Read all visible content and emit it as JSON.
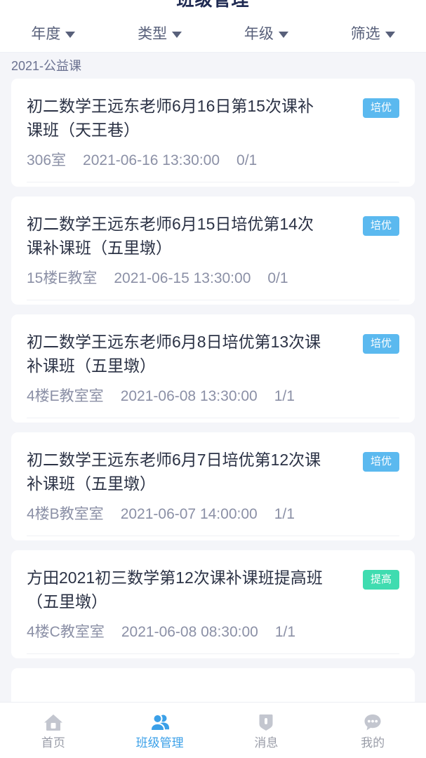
{
  "header": {
    "title": "班级管理"
  },
  "filters": [
    {
      "label": "年度",
      "icon": "chevron-down-icon"
    },
    {
      "label": "类型",
      "icon": "chevron-down-icon"
    },
    {
      "label": "年级",
      "icon": "chevron-down-icon"
    },
    {
      "label": "筛选",
      "icon": "chevron-down-icon"
    }
  ],
  "section": {
    "label": "2021-公益课"
  },
  "colors": {
    "page_background": "#f4f5f9",
    "card_background": "#ffffff",
    "title_text": "#1f2a52",
    "badge_peiyou": "#5bb9ef",
    "badge_tigao": "#3fdcb0",
    "active_tab": "#3ba0e8",
    "inactive_tab": "#9a9da8"
  },
  "classes": [
    {
      "title": "初二数学王远东老师6月16日第15次课补课班（天王巷）",
      "badge": "培优",
      "badge_type": "peiyou",
      "room": "306室",
      "datetime": "2021-06-16 13:30:00",
      "enrollment": "0/1"
    },
    {
      "title": "初二数学王远东老师6月15日培优第14次课补课班（五里墩）",
      "badge": "培优",
      "badge_type": "peiyou",
      "room": "15楼E教室",
      "datetime": "2021-06-15 13:30:00",
      "enrollment": "0/1"
    },
    {
      "title": "初二数学王远东老师6月8日培优第13次课补课班（五里墩）",
      "badge": "培优",
      "badge_type": "peiyou",
      "room": "4楼E教室室",
      "datetime": "2021-06-08 13:30:00",
      "enrollment": "1/1"
    },
    {
      "title": "初二数学王远东老师6月7日培优第12次课补课班（五里墩）",
      "badge": "培优",
      "badge_type": "peiyou",
      "room": "4楼B教室室",
      "datetime": "2021-06-07 14:00:00",
      "enrollment": "1/1"
    },
    {
      "title": "方田2021初三数学第12次课补课班提高班（五里墩）",
      "badge": "提高",
      "badge_type": "tigao",
      "room": "4楼C教室室",
      "datetime": "2021-06-08 08:30:00",
      "enrollment": "1/1"
    }
  ],
  "tabs": [
    {
      "label": "首页",
      "icon": "home-icon",
      "active": false
    },
    {
      "label": "班级管理",
      "icon": "people-icon",
      "active": true
    },
    {
      "label": "消息",
      "icon": "message-icon",
      "active": false
    },
    {
      "label": "我的",
      "icon": "chat-dots-icon",
      "active": false
    }
  ]
}
